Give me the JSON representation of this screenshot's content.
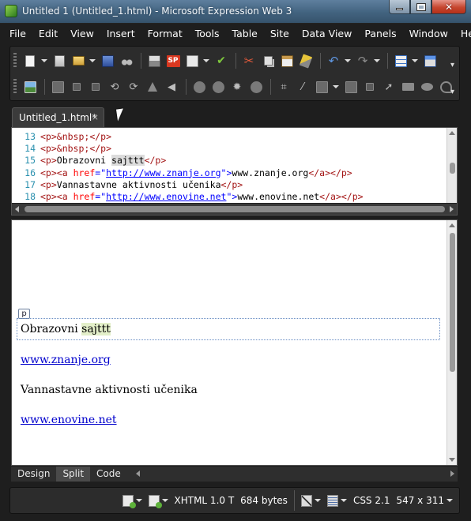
{
  "window": {
    "title": "Untitled 1 (Untitled_1.html) - Microsoft Expression Web 3"
  },
  "menu": [
    "File",
    "Edit",
    "View",
    "Insert",
    "Format",
    "Tools",
    "Table",
    "Site",
    "Data View",
    "Panels",
    "Window",
    "Help"
  ],
  "toolbar": {
    "row1_icons": [
      "new-page-icon",
      "open-icon",
      "folder-icon",
      "save-icon",
      "find-icon",
      "print-icon",
      "sharepoint-icon",
      "preview-icon",
      "spelling-icon",
      "cut-icon",
      "copy-icon",
      "paste-icon",
      "format-painter-icon",
      "undo-icon",
      "redo-icon",
      "insert-table-icon",
      "panel-icon"
    ],
    "row2_icons": [
      "insert-picture-icon",
      "layer-icon",
      "bring-forward-icon",
      "send-backward-icon",
      "rotate-left-icon",
      "rotate-right-icon",
      "flip-horizontal-icon",
      "flip-vertical-icon",
      "contrast-icon",
      "brightness-icon",
      "color-icon",
      "sharpen-icon",
      "crop-icon",
      "line-icon",
      "wrap-icon",
      "auto-thumbnail-icon",
      "select-icon",
      "rectangle-icon",
      "circle-icon",
      "polygon-icon"
    ],
    "sharepoint_label": "SP",
    "spelling_label": "ABC"
  },
  "document_tab": {
    "label": "Untitled_1.html*",
    "close": "×"
  },
  "code": {
    "lines": [
      {
        "num": "13",
        "before": "",
        "tag_open": "<p>",
        "entity": "&nbsp;",
        "tag_close": "</p>"
      },
      {
        "num": "14",
        "before": "",
        "tag_open": "<p>",
        "entity": "&nbsp;",
        "tag_close": "</p>"
      },
      {
        "num": "15",
        "tag_open": "<p>",
        "text": "Obrazovni ",
        "highlight": "sajttt",
        "tag_close": "</p>"
      },
      {
        "num": "16",
        "tag_open": "<p>",
        "a_open": "<a ",
        "attr": "href",
        "eq": "=\"",
        "url": "http://www.znanje.org",
        "end": "\">",
        "text": "www.znanje.org",
        "a_close": "</a>",
        "tag_close": "</p>"
      },
      {
        "num": "17",
        "tag_open": "<p>",
        "text": "Vannastavne aktivnosti učenika",
        "tag_close": "</p>"
      },
      {
        "num": "18",
        "tag_open": "<p>",
        "a_open": "<a ",
        "attr": "href",
        "eq": "=\"",
        "url": "http://www.enovine.net",
        "end": "\">",
        "text": "www.enovine.net",
        "a_close": "</a>",
        "tag_close": "</p>"
      }
    ]
  },
  "design": {
    "p_badge": "p",
    "heading_text": "Obrazovni ",
    "heading_highlight": "sajttt",
    "link1": "www.znanje.org",
    "paragraph": "Vannastavne aktivnosti učenika",
    "link2": "www.enovine.net"
  },
  "view_tabs": [
    "Design",
    "Split",
    "Code"
  ],
  "active_view": "Split",
  "status": {
    "doctype": "XHTML 1.0 T",
    "size": "684 bytes",
    "css": "CSS 2.1",
    "dimensions": "547 x 311"
  }
}
